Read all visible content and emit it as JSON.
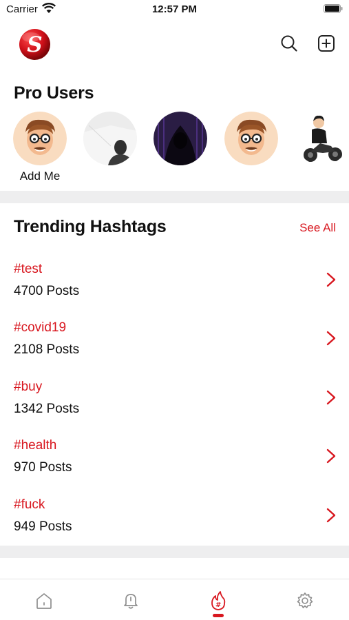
{
  "status_bar": {
    "carrier": "Carrier",
    "time": "12:57 PM"
  },
  "header": {
    "logo_letter": "S",
    "search_icon": "search-icon",
    "add_icon": "plus-square-icon"
  },
  "pro_users": {
    "title": "Pro Users",
    "items": [
      {
        "label": "Add Me",
        "avatar": "memoji-avatar"
      },
      {
        "label": "",
        "avatar": "photo-avatar-man"
      },
      {
        "label": "",
        "avatar": "hooded-figure-avatar"
      },
      {
        "label": "",
        "avatar": "memoji-avatar"
      },
      {
        "label": "",
        "avatar": "motorcycle-avatar"
      }
    ]
  },
  "trending": {
    "title": "Trending Hashtags",
    "see_all": "See All",
    "items": [
      {
        "tag": "#test",
        "count": "4700 Posts"
      },
      {
        "tag": "#covid19",
        "count": "2108 Posts"
      },
      {
        "tag": "#buy",
        "count": "1342 Posts"
      },
      {
        "tag": "#health",
        "count": "970 Posts"
      },
      {
        "tag": "#fuck",
        "count": "949 Posts"
      }
    ]
  },
  "tab_bar": {
    "tabs": [
      "home-icon",
      "bell-icon",
      "hashtag-fire-icon",
      "gear-icon"
    ],
    "active_index": 2
  },
  "colors": {
    "accent": "#d8171f",
    "divider": "#eeeeef",
    "text": "#111111"
  }
}
